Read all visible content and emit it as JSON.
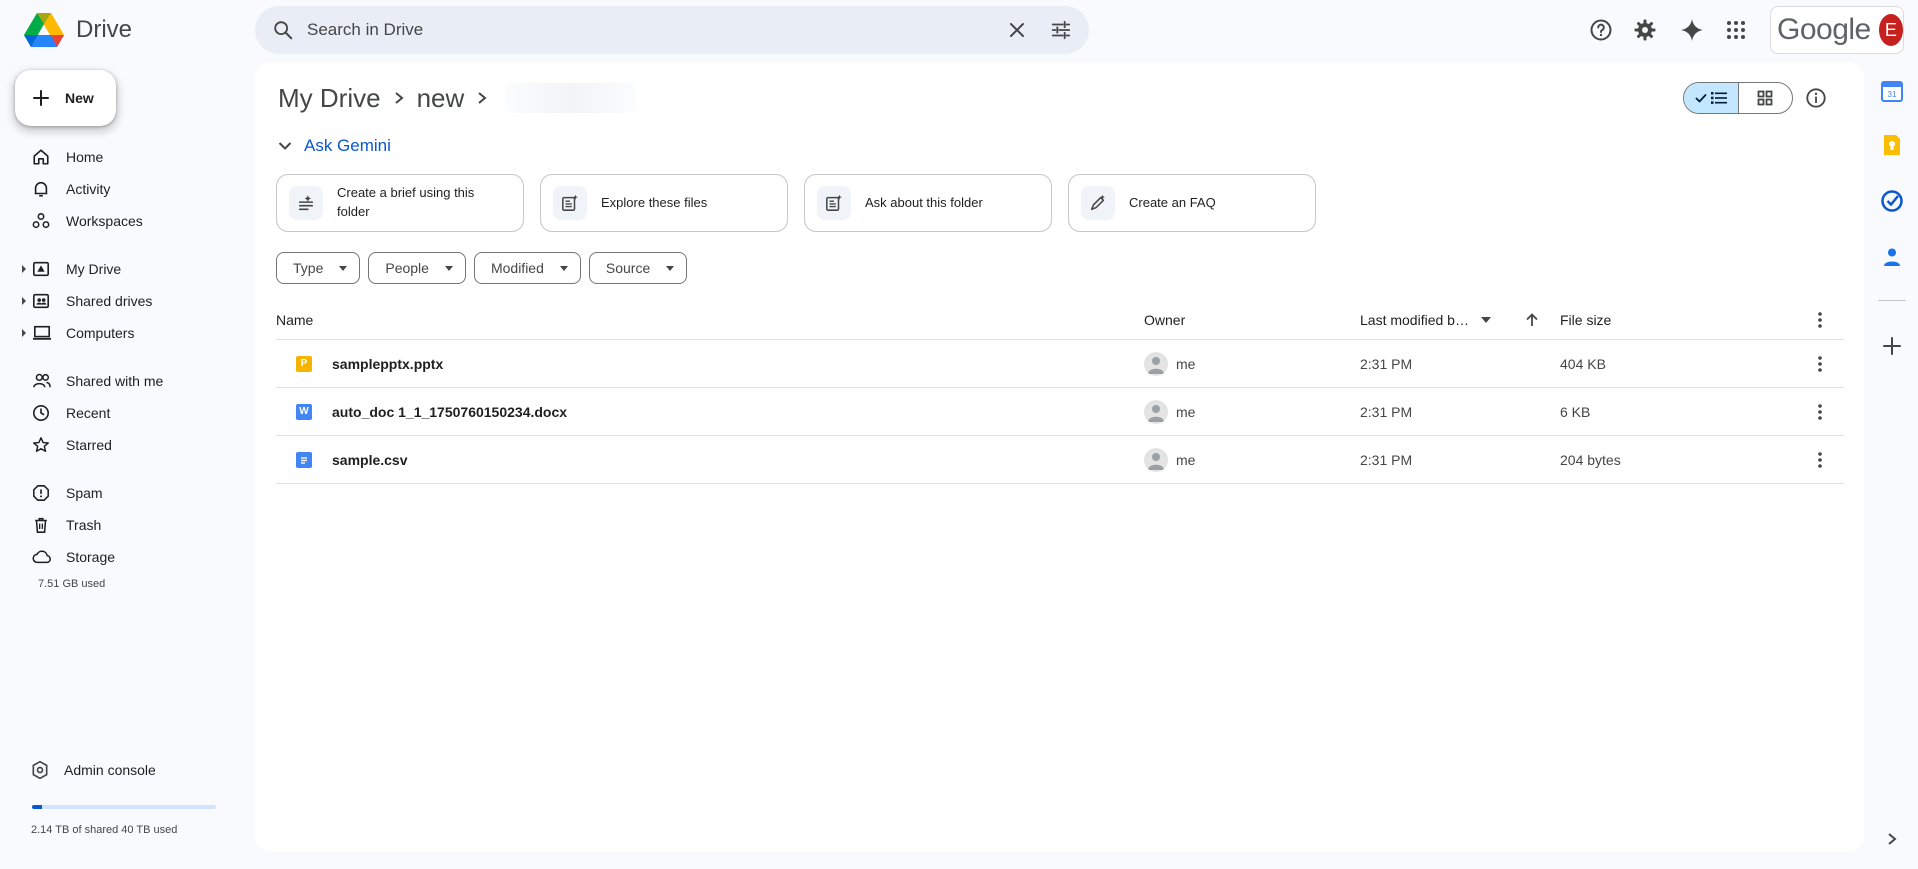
{
  "app": {
    "name": "Drive"
  },
  "search": {
    "placeholder": "Search in Drive"
  },
  "header": {
    "google_word": "Google",
    "avatar_letter": "E"
  },
  "sidebar": {
    "new_label": "New",
    "groups": [
      [
        {
          "label": "Home",
          "icon": "home-icon"
        },
        {
          "label": "Activity",
          "icon": "bell-icon"
        },
        {
          "label": "Workspaces",
          "icon": "workspaces-icon"
        }
      ],
      [
        {
          "label": "My Drive",
          "icon": "my-drive-icon",
          "expandable": true
        },
        {
          "label": "Shared drives",
          "icon": "shared-drives-icon",
          "expandable": true
        },
        {
          "label": "Computers",
          "icon": "computer-icon",
          "expandable": true
        }
      ],
      [
        {
          "label": "Shared with me",
          "icon": "people-icon"
        },
        {
          "label": "Recent",
          "icon": "clock-icon"
        },
        {
          "label": "Starred",
          "icon": "star-icon"
        }
      ],
      [
        {
          "label": "Spam",
          "icon": "spam-icon"
        },
        {
          "label": "Trash",
          "icon": "trash-icon"
        },
        {
          "label": "Storage",
          "icon": "cloud-icon"
        }
      ]
    ],
    "storage_used": "7.51 GB used",
    "admin_console": "Admin console",
    "quota_text": "2.14 TB of shared 40 TB used",
    "quota_fraction": 0.054
  },
  "breadcrumb": {
    "root": "My Drive",
    "current": "new"
  },
  "gemini": {
    "heading": "Ask Gemini",
    "chips": [
      {
        "label": "Create a brief using this folder",
        "icon": "brief-icon"
      },
      {
        "label": "Explore these files",
        "icon": "explore-icon"
      },
      {
        "label": "Ask about this folder",
        "icon": "ask-icon"
      },
      {
        "label": "Create an FAQ",
        "icon": "faq-icon"
      }
    ]
  },
  "filters": [
    "Type",
    "People",
    "Modified",
    "Source"
  ],
  "table": {
    "headers": {
      "name": "Name",
      "owner": "Owner",
      "modified": "Last modified b…",
      "size": "File size"
    },
    "rows": [
      {
        "name": "samplepptx.pptx",
        "owner": "me",
        "modified": "2:31 PM",
        "size": "404 KB",
        "type": "slides",
        "badge": "P",
        "color": "#f4b400"
      },
      {
        "name": "auto_doc 1_1_1750760150234.docx",
        "owner": "me",
        "modified": "2:31 PM",
        "size": "6 KB",
        "type": "word",
        "badge": "W",
        "color": "#4285f4"
      },
      {
        "name": "sample.csv",
        "owner": "me",
        "modified": "2:31 PM",
        "size": "204 bytes",
        "type": "doc",
        "badge": "",
        "color": "#4285f4"
      }
    ]
  },
  "colors": {
    "accent": "#0b57d0",
    "toggle_active": "#c2e7ff",
    "avatar": "#c5221f"
  }
}
